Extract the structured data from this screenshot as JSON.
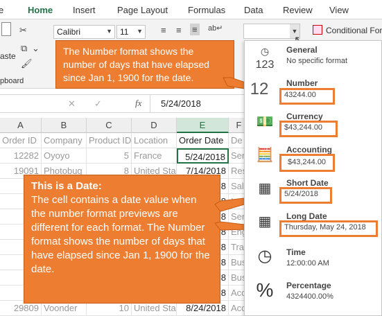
{
  "tabs": [
    "Home",
    "Insert",
    "Page Layout",
    "Formulas",
    "Data",
    "Review",
    "View"
  ],
  "font": {
    "name": "Calibri",
    "size": "11"
  },
  "ribbon": {
    "paste": "aste",
    "clipboard": "pboard",
    "conditional": "Conditional For"
  },
  "formula": {
    "value": "5/24/2018",
    "fx": "fx"
  },
  "columns": [
    "A",
    "B",
    "C",
    "D",
    "E",
    "F"
  ],
  "headers": [
    "Order ID",
    "Company",
    "Product ID",
    "Location",
    "Order Date",
    "De"
  ],
  "rows": [
    [
      "12282",
      "Oyoyo",
      "5",
      "France",
      "5/24/2018",
      "Ser"
    ],
    [
      "19091",
      "Photobug",
      "8",
      "United States",
      "7/14/2018",
      "Res"
    ],
    [
      "",
      "",
      "",
      "",
      "8",
      "Sal"
    ],
    [
      "",
      "",
      "",
      "",
      "8",
      "Ins"
    ],
    [
      "",
      "",
      "",
      "",
      "8",
      "Ser"
    ],
    [
      "",
      "",
      "",
      "",
      "8",
      "Eng"
    ],
    [
      "",
      "",
      "",
      "",
      "8",
      "Tra"
    ],
    [
      "",
      "",
      "",
      "",
      "8",
      "Bus"
    ],
    [
      "",
      "",
      "",
      "",
      "8",
      "Bus"
    ],
    [
      "",
      "",
      "",
      "",
      "8",
      "Acc"
    ],
    [
      "29809",
      "Voonder",
      "10",
      "United States",
      "8/24/2018",
      "Acc"
    ]
  ],
  "callout_top": "The Number format shows the number of days that have elapsed since Jan 1, 1900 for the date.",
  "callout_main": {
    "title": "This is a Date:",
    "body": "The cell contains a date value when the number format previews are different for each format.  The Number format shows the number of days that have elapsed since Jan 1, 1900 for the date."
  },
  "formats": [
    {
      "name": "General",
      "preview": "No specific format",
      "icon": "123-icon"
    },
    {
      "name": "Number",
      "preview": "43244.00",
      "icon": "12-icon"
    },
    {
      "name": "Currency",
      "preview": "$43,244.00",
      "icon": "currency-icon"
    },
    {
      "name": "Accounting",
      "preview": "$43,244.00",
      "icon": "accounting-icon"
    },
    {
      "name": "Short Date",
      "preview": "5/24/2018",
      "icon": "calendar-icon"
    },
    {
      "name": "Long Date",
      "preview": "Thursday, May 24, 2018",
      "icon": "calendar-icon"
    },
    {
      "name": "Time",
      "preview": "12:00:00 AM",
      "icon": "clock-icon"
    },
    {
      "name": "Percentage",
      "preview": "4324400.00%",
      "icon": "percent-icon"
    }
  ],
  "accent": "#ed7d31",
  "excel_green": "#217346"
}
